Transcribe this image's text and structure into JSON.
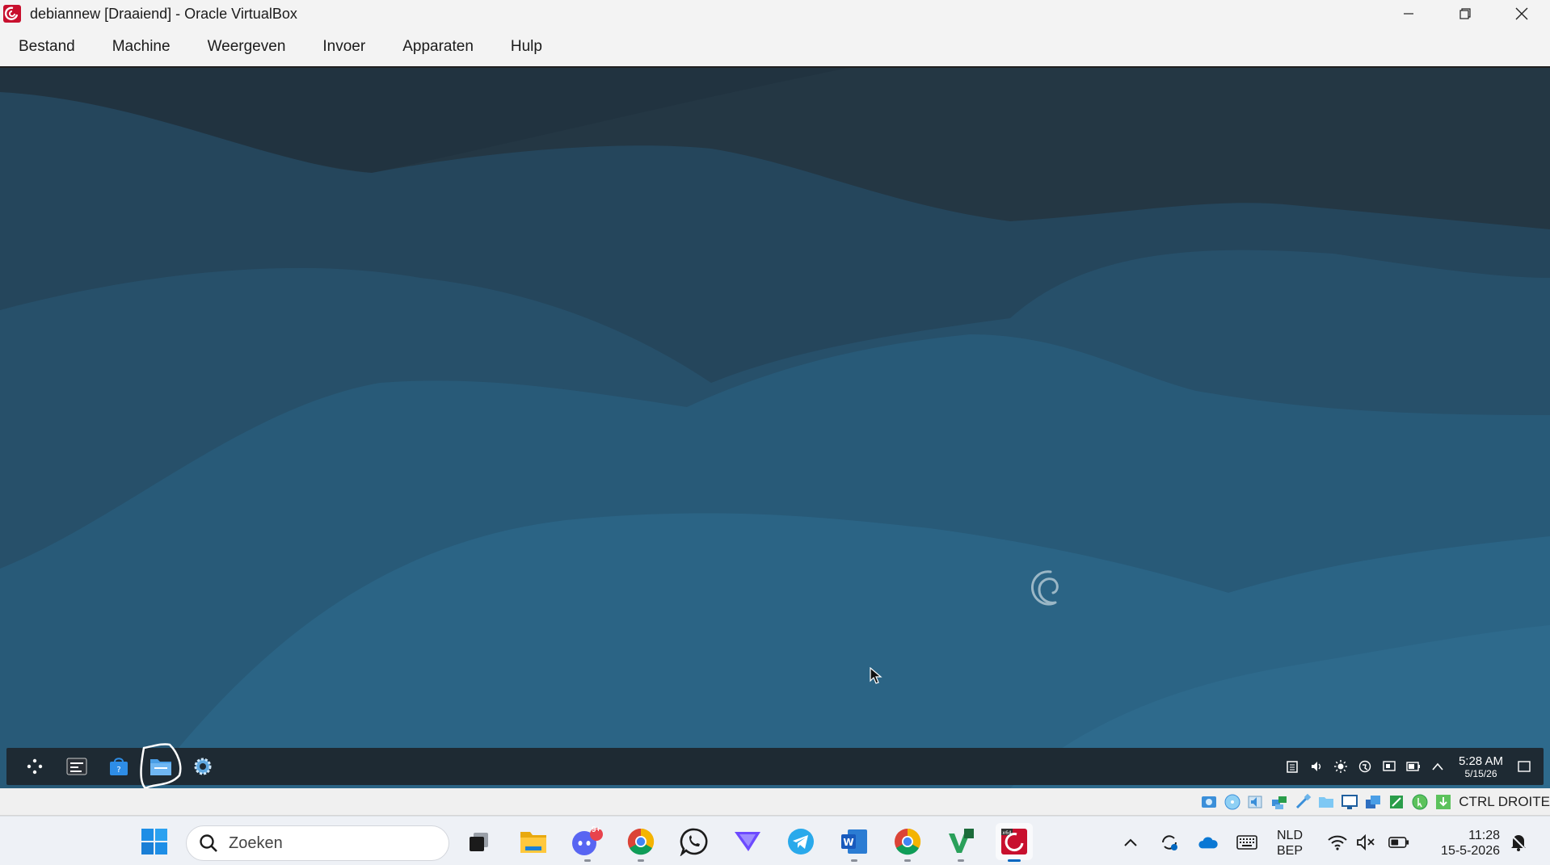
{
  "window": {
    "title": "debiannew [Draaiend] - Oracle VirtualBox",
    "app_icon": "virtualbox-debian-icon",
    "controls": [
      "minimize-icon",
      "restore-icon",
      "close-icon"
    ]
  },
  "menu": {
    "items": [
      "Bestand",
      "Machine",
      "Weergeven",
      "Invoer",
      "Apparaten",
      "Hulp"
    ]
  },
  "guest": {
    "wallpaper": "debian-blue-hills",
    "colors": {
      "dark": "#243744",
      "mid": "#27506a",
      "light": "#2b6485",
      "panel": "#1e2a33"
    },
    "panel": {
      "launchers": [
        "app-menu-icon",
        "terminal-icon",
        "software-store-icon",
        "file-manager-icon",
        "settings-icon"
      ],
      "tray": [
        "clipboard-icon",
        "volume-icon",
        "brightness-icon",
        "network-icon",
        "display-icon",
        "battery-icon",
        "chevron-up-icon"
      ],
      "time": "5:28 AM",
      "date": "5/15/26"
    }
  },
  "vbox_status": {
    "icons": [
      "hard-disk-icon",
      "optical-drive-icon",
      "audio-icon",
      "network-adapter-icon",
      "usb-icon",
      "shared-folders-icon",
      "display-icon",
      "recording-icon",
      "cpu-icon",
      "mouse-integration-icon",
      "keyboard-icon"
    ],
    "host_key": "CTRL DROITE"
  },
  "taskbar": {
    "search_placeholder": "Zoeken",
    "apps": [
      "start-icon",
      "task-view-icon",
      "file-explorer-icon",
      "discord-icon",
      "chrome-icon",
      "whatsapp-icon",
      "proton-vpn-icon",
      "telegram-icon",
      "word-icon",
      "chrome-profile-icon",
      "visual-studio-icon",
      "virtualbox-icon"
    ],
    "discord_badge": "9+",
    "lang_line1": "NLD",
    "lang_line2": "BEP",
    "time": "11:28",
    "date": "15-5-2026",
    "accent": "#0067c0"
  }
}
